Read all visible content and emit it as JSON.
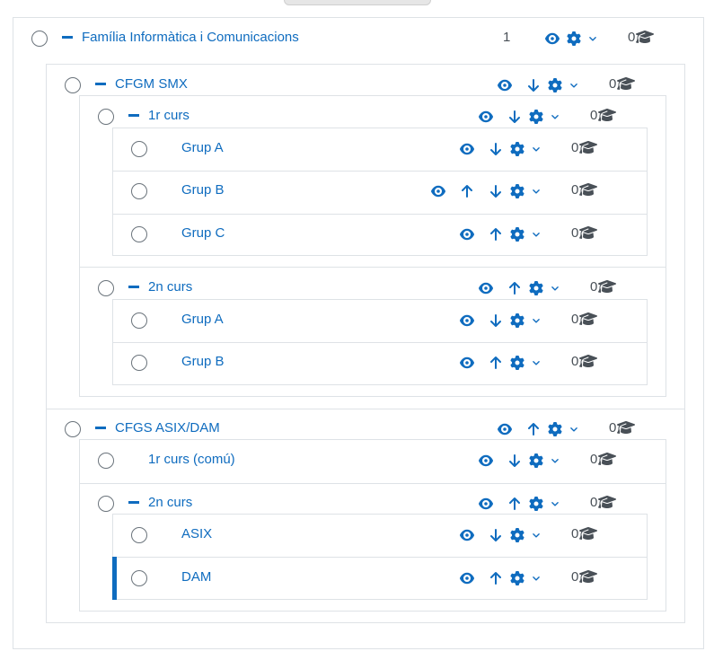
{
  "colors": {
    "accent": "#0f6cbf",
    "border": "#dee2e6",
    "text": "#495057"
  },
  "icons": {
    "eye": "eye-icon",
    "up": "arrow-up-icon",
    "down": "arrow-down-icon",
    "gear": "gear-icon",
    "chevron": "chevron-down-icon",
    "cap": "graduation-cap-icon"
  },
  "categories": {
    "root": {
      "name": "Família Informàtica i Comunicacions",
      "subcategories": "1",
      "courses": "0"
    },
    "smx": {
      "name": "CFGM SMX",
      "courses": "0"
    },
    "smx_1r": {
      "name": "1r curs",
      "courses": "0"
    },
    "smx_1r_a": {
      "name": "Grup A",
      "courses": "0"
    },
    "smx_1r_b": {
      "name": "Grup B",
      "courses": "0"
    },
    "smx_1r_c": {
      "name": "Grup C",
      "courses": "0"
    },
    "smx_2n": {
      "name": "2n curs",
      "courses": "0"
    },
    "smx_2n_a": {
      "name": "Grup A",
      "courses": "0"
    },
    "smx_2n_b": {
      "name": "Grup B",
      "courses": "0"
    },
    "asix": {
      "name": "CFGS ASIX/DAM",
      "courses": "0"
    },
    "asix_1r": {
      "name": "1r curs (comú)",
      "courses": "0"
    },
    "asix_2n": {
      "name": "2n curs",
      "courses": "0"
    },
    "asix_2n_asix": {
      "name": "ASIX",
      "courses": "0"
    },
    "asix_2n_dam": {
      "name": "DAM",
      "courses": "0"
    }
  }
}
